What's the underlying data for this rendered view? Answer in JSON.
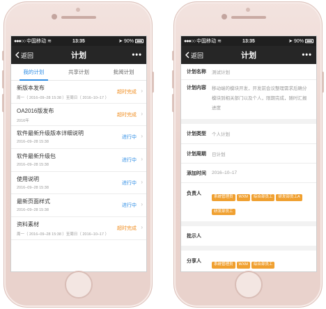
{
  "status_bar": {
    "carrier": "中国移动",
    "time": "13:35",
    "battery": "90%"
  },
  "left": {
    "nav": {
      "back_label": "返回",
      "title": "计划"
    },
    "tabs": [
      {
        "label": "我的计划",
        "active": true
      },
      {
        "label": "共享计划",
        "active": false
      },
      {
        "label": "批阅计划",
        "active": false
      }
    ],
    "items": [
      {
        "name": "新版本发布",
        "sub": "周一（ 2016–09–28  15:38 ）至周日（ 2016–10–17 ）",
        "status": "超时完成",
        "status_color": "#f08c1e"
      },
      {
        "name": "OA2016版发布",
        "sub": "2016年",
        "status": "超时完成",
        "status_color": "#f08c1e"
      },
      {
        "name": "软件最新升级版本详细说明",
        "sub": "2016–09–28  15:38",
        "status": "进行中",
        "status_color": "#2e8de5"
      },
      {
        "name": "软件最新升级包",
        "sub": "2016–09–28  15:38",
        "status": "进行中",
        "status_color": "#2e8de5"
      },
      {
        "name": "使用说明",
        "sub": "2016–09–28  15:38",
        "status": "进行中",
        "status_color": "#2e8de5"
      },
      {
        "name": "最新页面样式",
        "sub": "2016–09–28  15:38",
        "status": "进行中",
        "status_color": "#2e8de5"
      },
      {
        "name": "资料素材",
        "sub": "周一（ 2016–09–28  15:38 ）至周日（ 2016–10–17 ）",
        "status": "超时完成",
        "status_color": "#f08c1e"
      }
    ]
  },
  "right": {
    "nav": {
      "back_label": "返回",
      "title": "计划"
    },
    "plan_name": {
      "label": "计划名称",
      "value": "测试计划"
    },
    "plan_content": {
      "label": "计划内容",
      "value": "移动端的模块开发，开发前会议整理需求后确分模块到相关部门以及个人，限期完成，随时汇报进度"
    },
    "plan_type": {
      "label": "计划类型",
      "value": "个人计划"
    },
    "plan_cycle": {
      "label": "计划周期",
      "value": "日计划"
    },
    "add_time": {
      "label": "添加时间",
      "value": "2016–10–17"
    },
    "owner": {
      "label": "负责人",
      "tags": [
        "系统管理员",
        "WXM",
        "综合部员工",
        "研发部员工A",
        "研发部员工"
      ]
    },
    "reviewer": {
      "label": "批示人"
    },
    "sharer": {
      "label": "分享人",
      "tags": [
        "系统管理员",
        "WXM",
        "综合部员工"
      ]
    }
  }
}
